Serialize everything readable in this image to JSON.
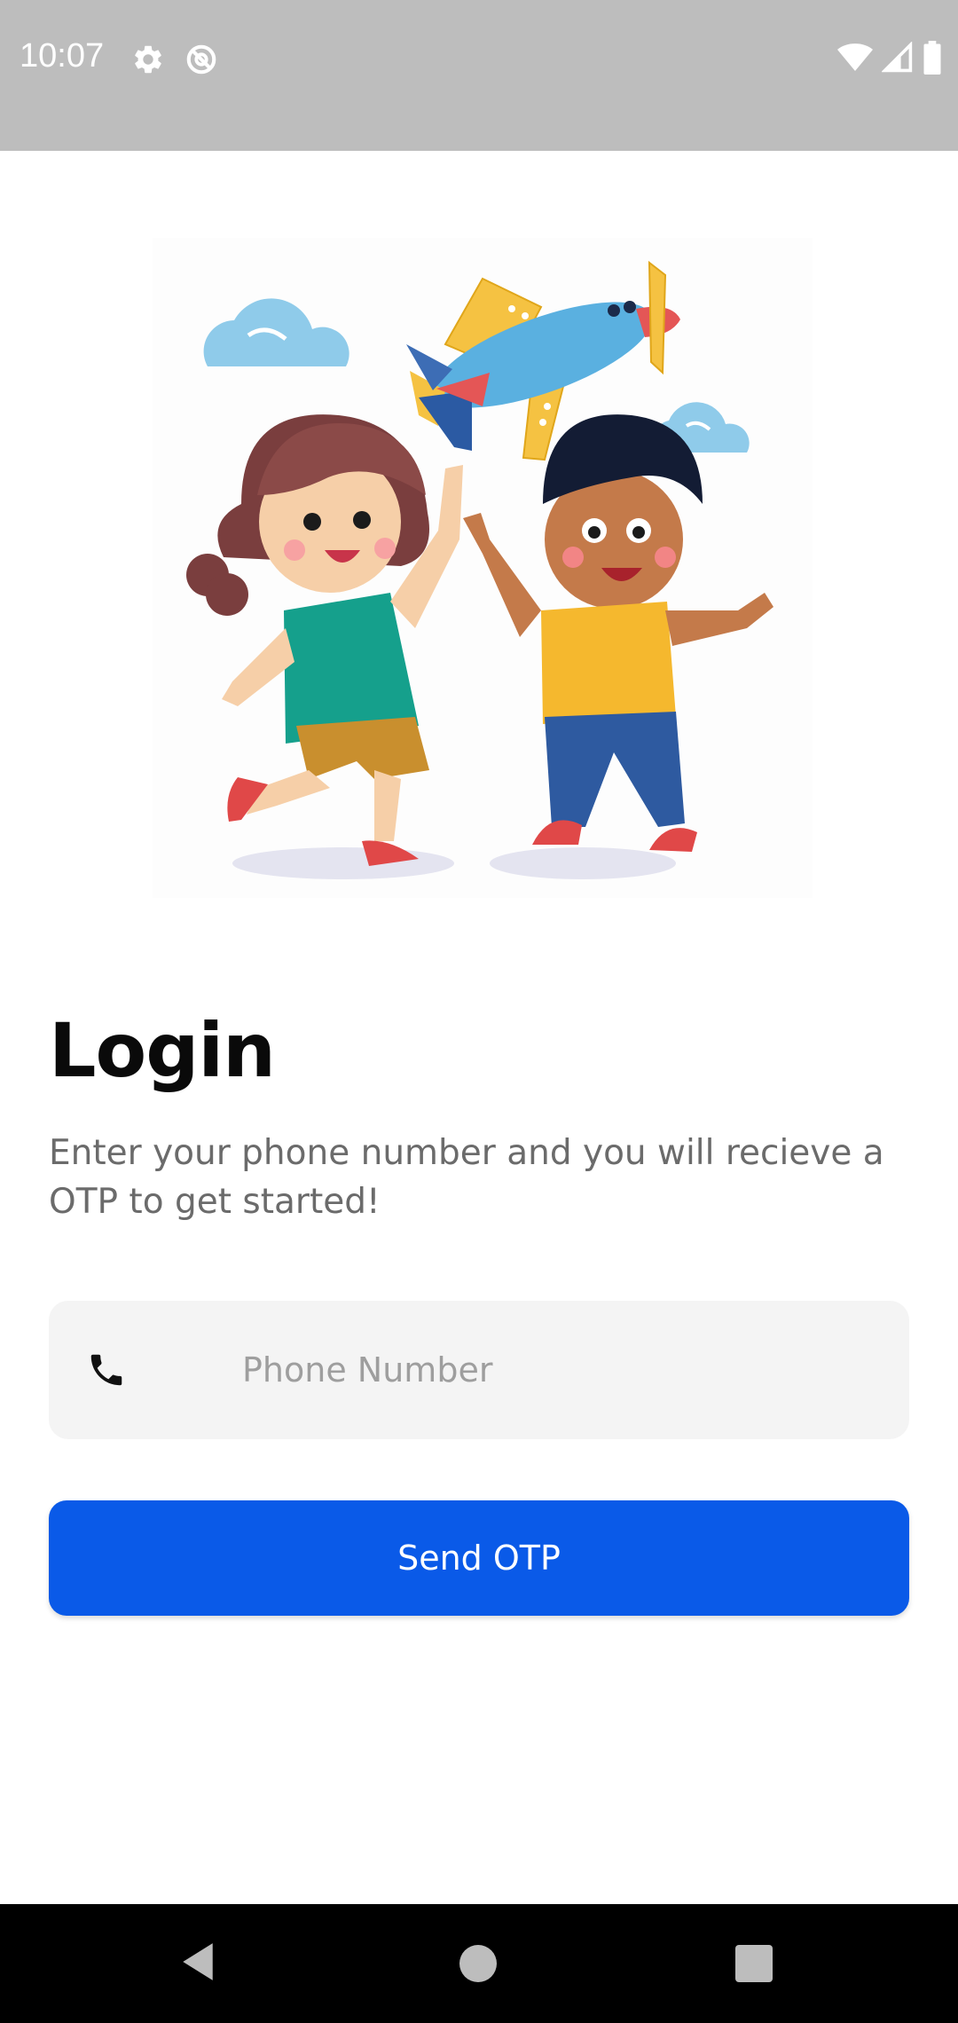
{
  "status_bar": {
    "time": "10:07",
    "icons": [
      "settings-gear-icon",
      "do-not-disturb-icon",
      "wifi-icon",
      "signal-icon",
      "battery-icon"
    ]
  },
  "illustration": {
    "icon": "kids-playing-with-airplane-illustration"
  },
  "login": {
    "title": "Login",
    "subtitle": "Enter your phone number and you will recieve a OTP to get started!",
    "phone_field": {
      "icon": "phone-icon",
      "placeholder": "Phone Number",
      "value": ""
    },
    "send_button_label": "Send OTP"
  },
  "nav_bar": {
    "icons": [
      "back-icon",
      "home-icon",
      "recents-icon"
    ]
  },
  "colors": {
    "accent": "#0a5ae8",
    "status_bar": "#bdbdbd",
    "field_background": "#f4f4f4",
    "title": "#0a0a0a",
    "subtitle": "#6b6b6b"
  }
}
